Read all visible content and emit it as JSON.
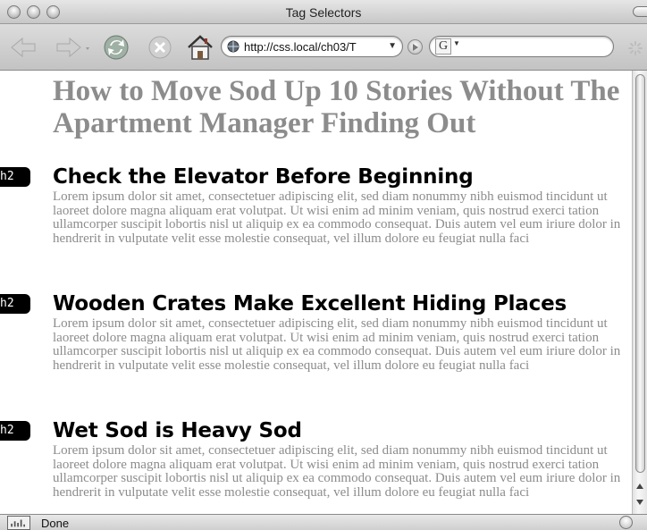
{
  "window": {
    "title": "Tag Selectors"
  },
  "toolbar": {
    "url": "http://css.local/ch03/T",
    "search_placeholder": ""
  },
  "page": {
    "title": "How to Move Sod Up 10 Stories Without The Apartment Manager Finding Out",
    "sections": [
      {
        "tag": "h2",
        "heading": "Check the Elevator Before Beginning",
        "body": "Lorem ipsum dolor sit amet, consectetuer adipiscing elit, sed diam nonummy nibh euismod tincidunt ut laoreet dolore magna aliquam erat volutpat. Ut wisi enim ad minim veniam, quis nostrud exerci tation ullamcorper suscipit lobortis nisl ut aliquip ex ea commodo consequat. Duis autem vel eum iriure dolor in hendrerit in vulputate velit esse molestie consequat, vel illum dolore eu feugiat nulla faci"
      },
      {
        "tag": "h2",
        "heading": "Wooden Crates Make Excellent Hiding Places",
        "body": "Lorem ipsum dolor sit amet, consectetuer adipiscing elit, sed diam nonummy nibh euismod tincidunt ut laoreet dolore magna aliquam erat volutpat. Ut wisi enim ad minim veniam, quis nostrud exerci tation ullamcorper suscipit lobortis nisl ut aliquip ex ea commodo consequat. Duis autem vel eum iriure dolor in hendrerit in vulputate velit esse molestie consequat, vel illum dolore eu feugiat nulla faci"
      },
      {
        "tag": "h2",
        "heading": "Wet Sod is Heavy Sod",
        "body": "Lorem ipsum dolor sit amet, consectetuer adipiscing elit, sed diam nonummy nibh euismod tincidunt ut laoreet dolore magna aliquam erat volutpat. Ut wisi enim ad minim veniam, quis nostrud exerci tation ullamcorper suscipit lobortis nisl ut aliquip ex ea commodo consequat. Duis autem vel eum iriure dolor in hendrerit in vulputate velit esse molestie consequat, vel illum dolore eu feugiat nulla faci"
      }
    ]
  },
  "status": {
    "text": "Done"
  },
  "colors": {
    "heading_gray": "#8c8c8c",
    "body_gray": "#8c8c8c",
    "tag_bg": "#000000"
  },
  "icons": [
    "back-icon",
    "forward-icon",
    "reload-icon",
    "stop-icon",
    "home-icon",
    "globe-icon",
    "go-icon",
    "google-icon",
    "spinner-icon",
    "status-icon",
    "security-icon"
  ]
}
